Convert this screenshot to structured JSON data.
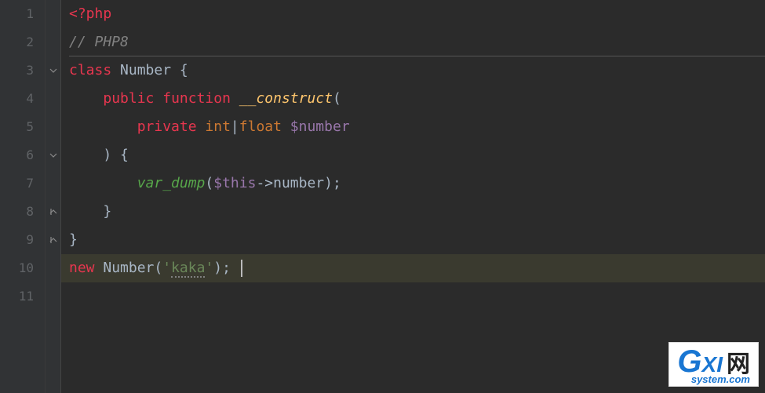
{
  "lines": {
    "l1_num": "1",
    "l2_num": "2",
    "l3_num": "3",
    "l4_num": "4",
    "l5_num": "5",
    "l6_num": "6",
    "l7_num": "7",
    "l8_num": "8",
    "l9_num": "9",
    "l10_num": "10",
    "l11_num": "11"
  },
  "code": {
    "l1_open": "<?php",
    "l2_comment": "// PHP8",
    "l3_class": "class",
    "l3_name": "Number",
    "l3_brace": " {",
    "l4_public": "public",
    "l4_function": "function",
    "l4_construct": "__construct",
    "l4_paren": "(",
    "l5_private": "private",
    "l5_int": "int",
    "l5_pipe": "|",
    "l5_float": "float",
    "l5_var": "$number",
    "l6_close_paren": ")",
    "l6_brace": " {",
    "l7_fn": "var_dump",
    "l7_open": "(",
    "l7_this": "$this",
    "l7_arrow": "->",
    "l7_prop": "number",
    "l7_close": ");",
    "l8_brace": "}",
    "l9_brace": "}",
    "l10_new": "new",
    "l10_class": "Number",
    "l10_open": "(",
    "l10_q1": "'",
    "l10_str": "kaka",
    "l10_q2": "'",
    "l10_close": ");"
  },
  "watermark": {
    "g": "G",
    "xi": "XI",
    "cn": "网",
    "sub": "system.com"
  }
}
